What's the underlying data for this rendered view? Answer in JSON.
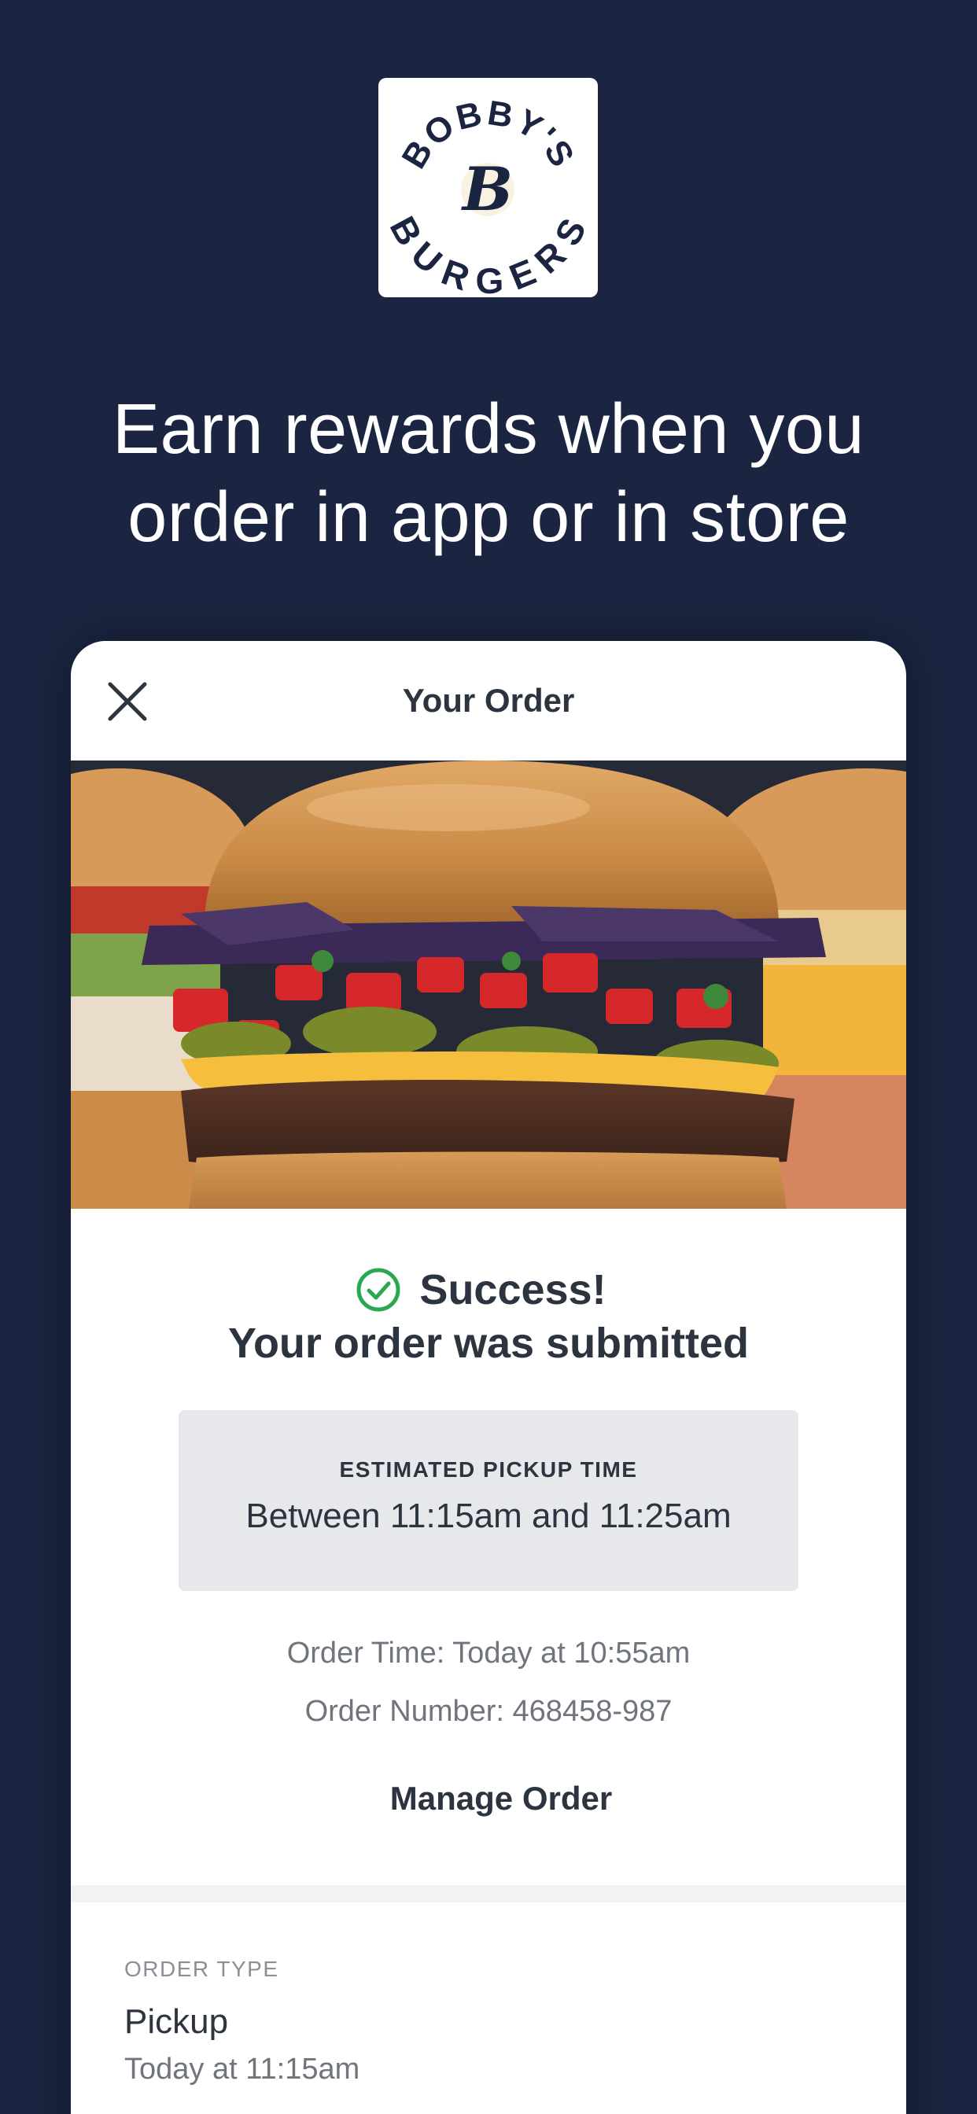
{
  "brand": {
    "logo_alt": "BOBBY'S BURGERS",
    "logo_initial": "B",
    "logo_top": "BOBBY'S",
    "logo_bottom": "BURGERS"
  },
  "headline": {
    "line1": "Earn rewards when you",
    "line2": "order in app or in store"
  },
  "order": {
    "title": "Your Order",
    "success_title": "Success!",
    "success_subtitle": "Your order was submitted",
    "pickup_label": "ESTIMATED PICKUP TIME",
    "pickup_value": "Between 11:15am and 11:25am",
    "order_time": "Order Time: Today at 10:55am",
    "order_number": "Order Number: 468458-987",
    "manage_label": "Manage Order",
    "order_type_label": "ORDER TYPE",
    "order_type_value": "Pickup",
    "order_type_time": "Today at 11:15am"
  },
  "colors": {
    "background": "#1b2541",
    "success_green": "#2aa84f",
    "text_dark": "#2c3440",
    "text_muted": "#6f747d"
  },
  "icons": {
    "close": "close-icon",
    "success": "check-circle-icon"
  }
}
